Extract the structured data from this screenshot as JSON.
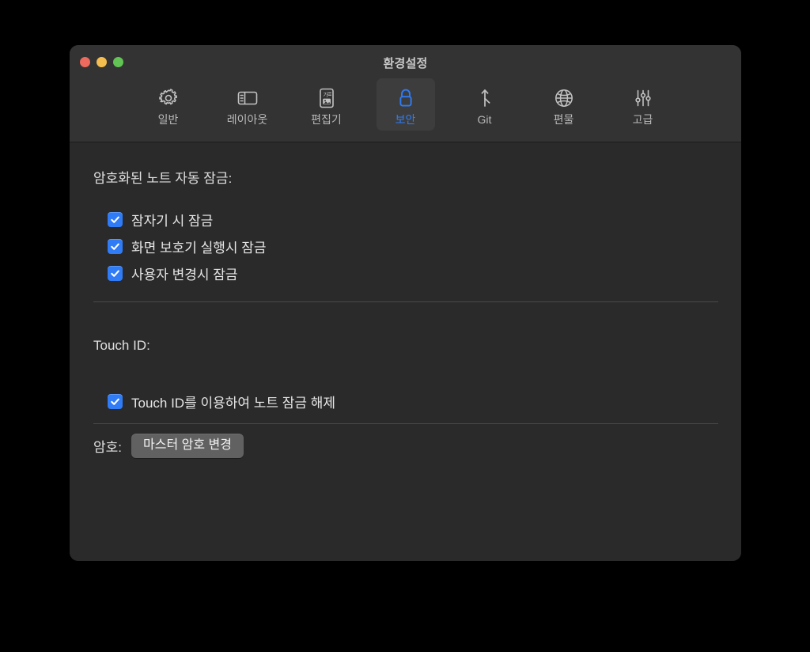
{
  "window": {
    "title": "환경설정",
    "traffic_lights": [
      {
        "name": "close",
        "color": "#ed6a5e"
      },
      {
        "name": "minimize",
        "color": "#f4bd4f"
      },
      {
        "name": "zoom",
        "color": "#61c454"
      }
    ]
  },
  "toolbar": {
    "selected_index": 3,
    "accent_color": "#2f7cf6",
    "tabs": [
      {
        "label": "일반",
        "icon": "gear-icon"
      },
      {
        "label": "레이아웃",
        "icon": "layout-sidebar-icon"
      },
      {
        "label": "편집기",
        "icon": "editor-document-icon"
      },
      {
        "label": "보안",
        "icon": "lock-icon"
      },
      {
        "label": "Git",
        "icon": "git-branch-icon"
      },
      {
        "label": "편물",
        "icon": "globe-icon"
      },
      {
        "label": "고급",
        "icon": "sliders-icon"
      }
    ]
  },
  "content": {
    "autolock": {
      "title": "암호화된 노트 자동 잠금:",
      "options": [
        {
          "label": "잠자기 시 잠금",
          "checked": true
        },
        {
          "label": "화면 보호기 실행시 잠금",
          "checked": true
        },
        {
          "label": "사용자 변경시 잠금",
          "checked": true
        }
      ]
    },
    "touch_id": {
      "title": "Touch ID:",
      "options": [
        {
          "label": "Touch ID를 이용하여 노트 잠금 해제",
          "checked": true
        }
      ]
    },
    "password": {
      "label": "암호:",
      "button_label": "마스터 암호 변경"
    }
  }
}
